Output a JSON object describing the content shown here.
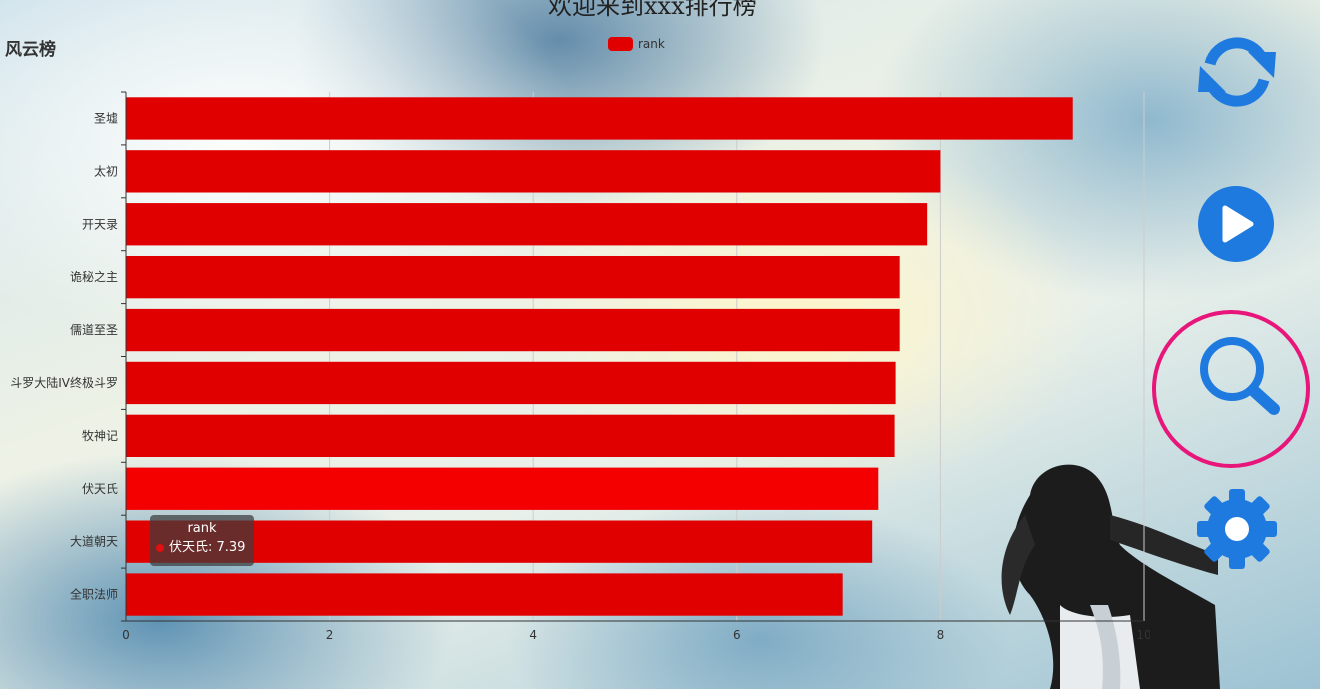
{
  "page": {
    "title": "欢迎来到xxx排行榜",
    "board_title": "风云榜"
  },
  "tooltip": {
    "series": "rank",
    "item": "伏天氏: 7.39"
  },
  "controls": [
    {
      "name": "refresh-icon"
    },
    {
      "name": "play-icon"
    },
    {
      "name": "search-icon"
    },
    {
      "name": "gear-icon"
    }
  ],
  "colors": {
    "bar": "#e00000",
    "bar_highlight": "#f40000",
    "icon": "#1f7ae0",
    "search_ring": "#e8157a"
  },
  "chart_data": {
    "type": "bar",
    "orientation": "horizontal",
    "categories": [
      "圣墟",
      "太初",
      "开天录",
      "诡秘之主",
      "儒道至圣",
      "斗罗大陆IV终极斗罗",
      "牧神记",
      "伏天氏",
      "大道朝天",
      "全职法师"
    ],
    "series": [
      {
        "name": "rank",
        "values": [
          9.3,
          8.0,
          7.87,
          7.6,
          7.6,
          7.56,
          7.55,
          7.39,
          7.33,
          7.04
        ]
      }
    ],
    "xlim": [
      0,
      10
    ],
    "xticks": [
      "0",
      "2",
      "4",
      "6",
      "8",
      "10"
    ],
    "highlighted_category": "伏天氏",
    "grid": true,
    "legend": "top-center"
  }
}
